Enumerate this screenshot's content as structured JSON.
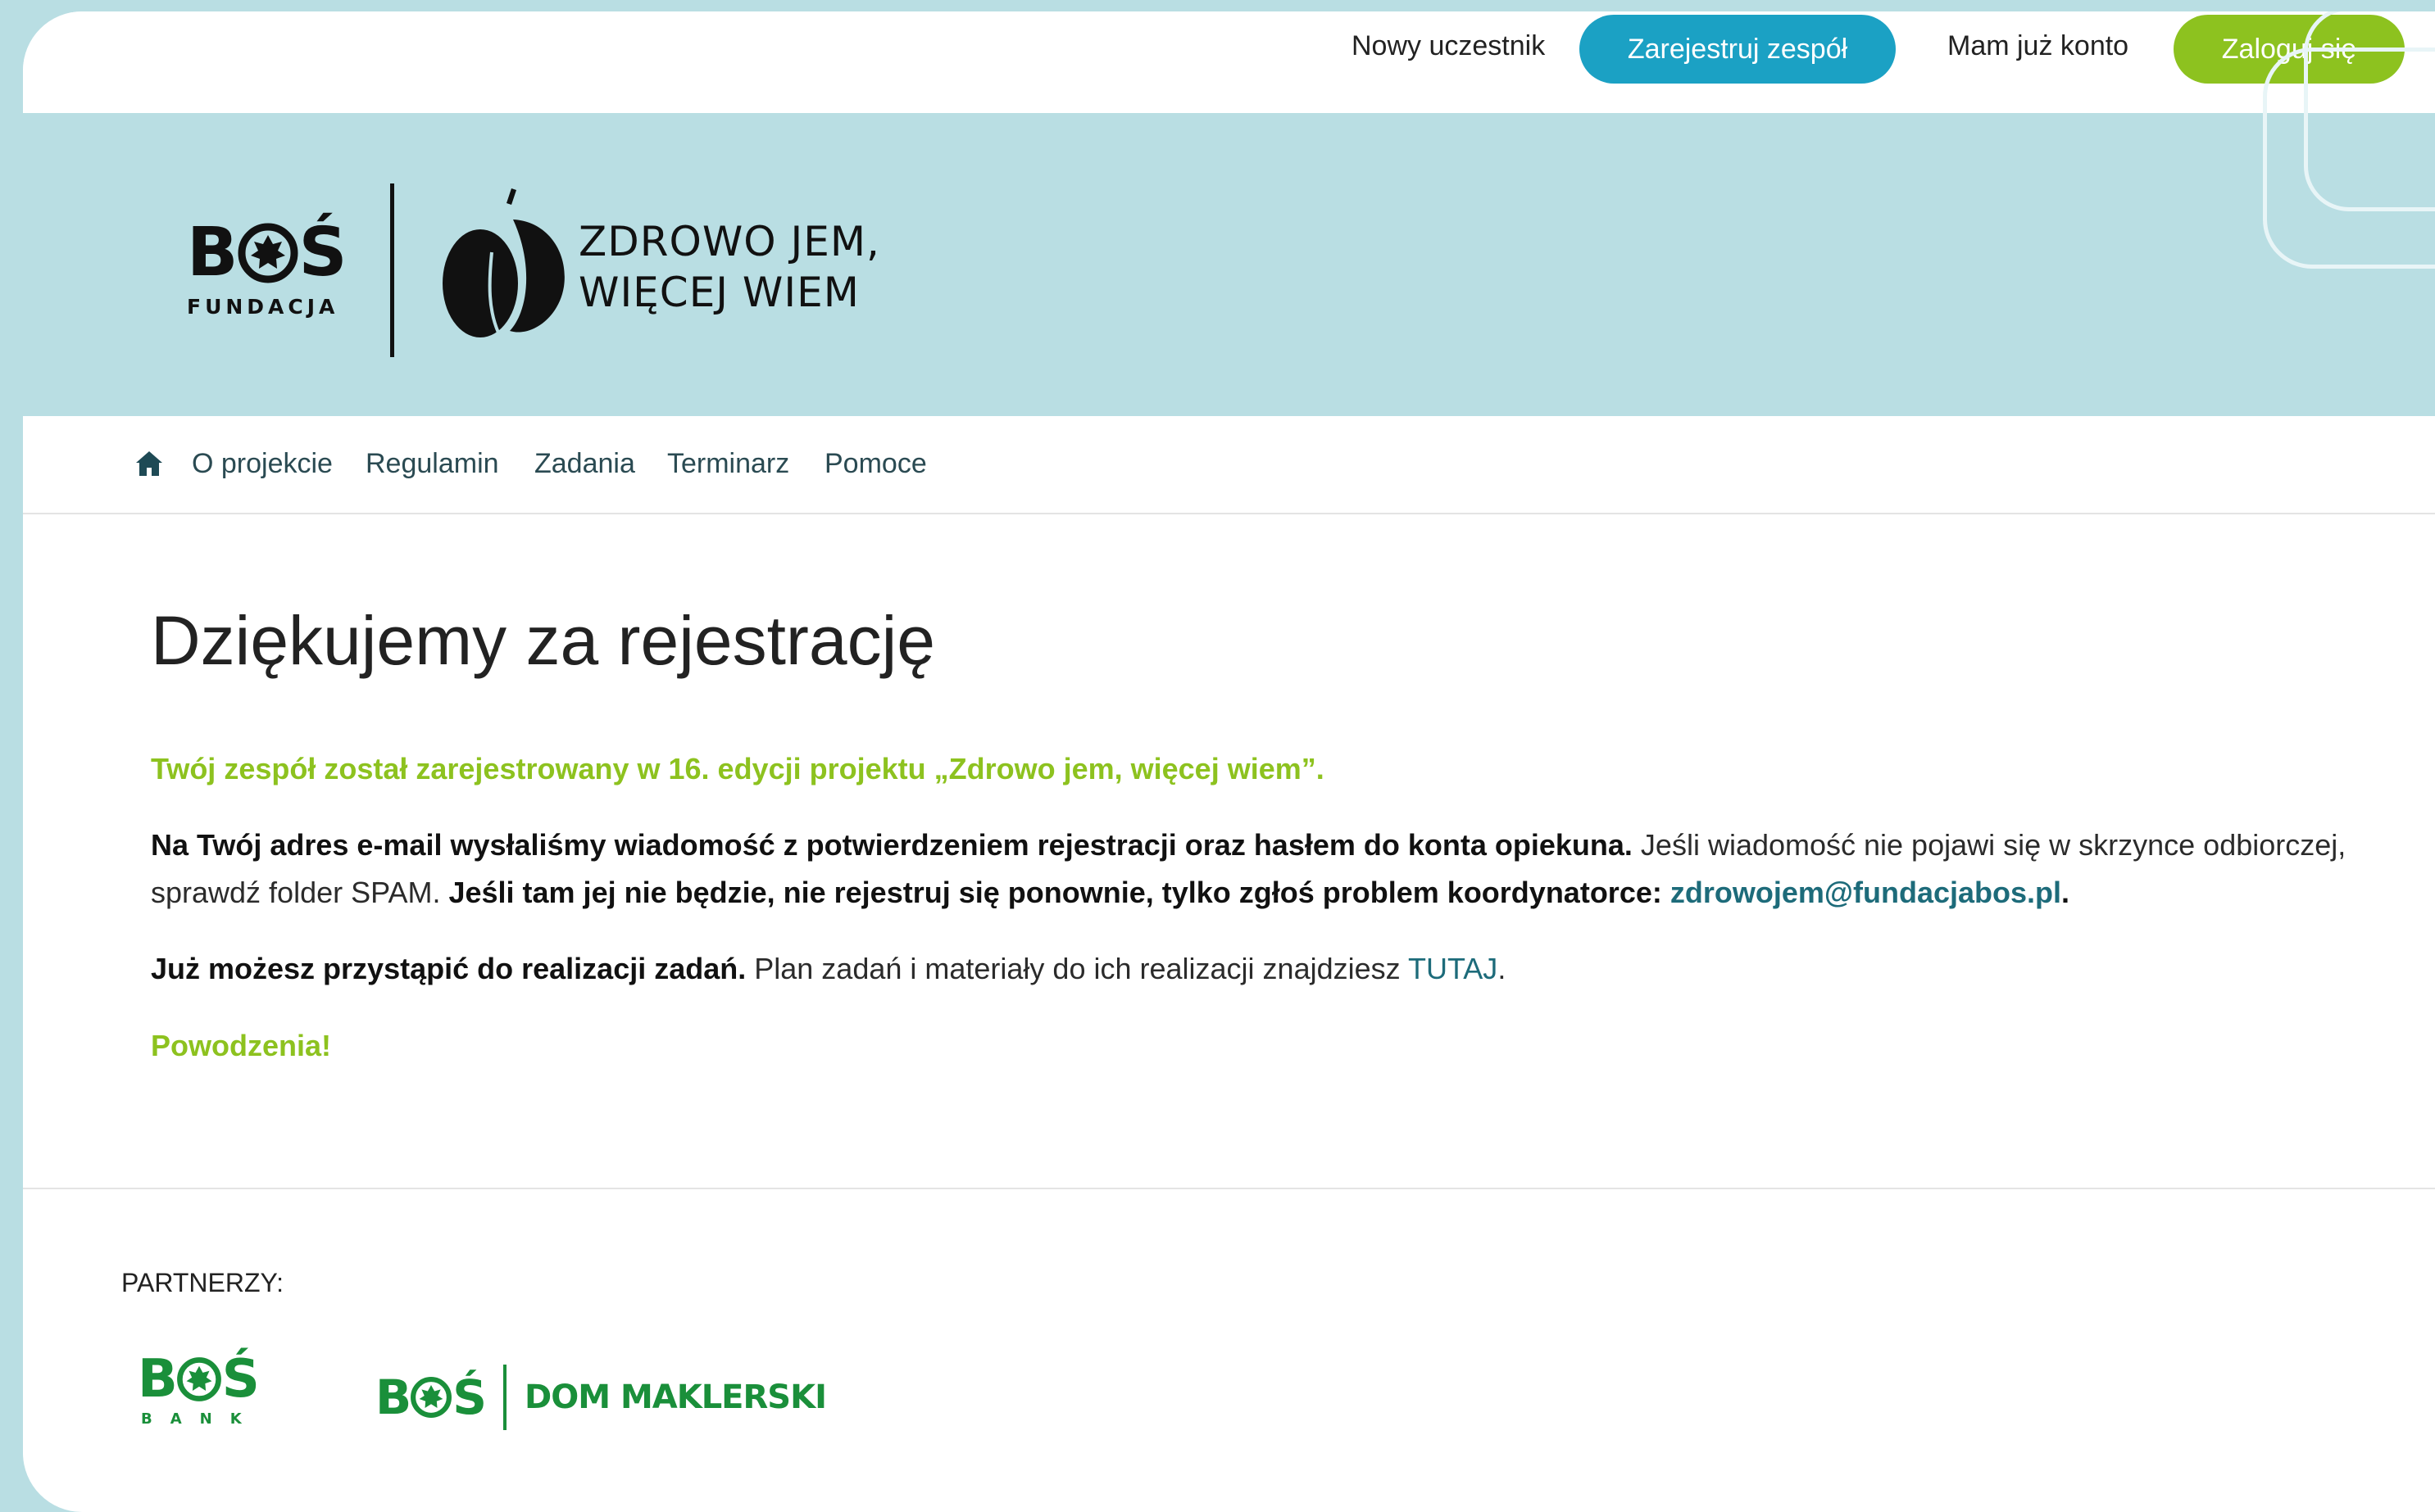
{
  "header": {
    "new_participant_text": "Nowy uczestnik",
    "register_button": "Zarejestruj zespół",
    "have_account_text": "Mam już konto",
    "login_button": "Zaloguj się"
  },
  "logos": {
    "bos_word_left": "B",
    "bos_word_right": "Ś",
    "bos_sub": "FUNDACJA",
    "project_line1": "ZDROWO JEM,",
    "project_line2": "WIĘCEJ WIEM"
  },
  "nav": {
    "items": [
      "O projekcie",
      "Regulamin",
      "Zadania",
      "Terminarz",
      "Pomoce"
    ]
  },
  "main": {
    "title": "Dziękujemy za rejestrację",
    "lead": "Twój zespół został zarejestrowany w 16. edycji projektu „Zdrowo jem, więcej wiem”.",
    "p1_bold": "Na Twój adres e-mail wysłaliśmy wiadomość z potwierdzeniem rejestracji oraz hasłem do konta opiekuna.",
    "p1_text": " Jeśli wiadomość nie pojawi się w skrzynce odbiorczej, sprawdź folder SPAM. ",
    "p1_bold2": "Jeśli tam jej nie będzie, nie rejestruj się ponownie, tylko zgłoś problem koordynatorce: ",
    "p1_email": "zdrowojem@fundacjabos.pl",
    "p1_end": ".",
    "p2_bold": "Już możesz przystąpić do realizacji zadań.",
    "p2_text": " Plan zadań i materiały do ich realizacji znajdziesz ",
    "p2_link": "TUTAJ",
    "p2_end": ".",
    "closing": "Powodzenia!"
  },
  "footer": {
    "partners_label": "PARTNERZY:",
    "bank_word_left": "B",
    "bank_word_right": "Ś",
    "bank_sub": "BANK",
    "dm_word_left": "B",
    "dm_word_right": "Ś",
    "dm_text": "DOM MAKLERSKI"
  },
  "colors": {
    "accent_blue": "#1ba1c4",
    "accent_green": "#8dc21f",
    "hero_bg": "#b9dee3",
    "partner_green": "#1a8f3a"
  }
}
